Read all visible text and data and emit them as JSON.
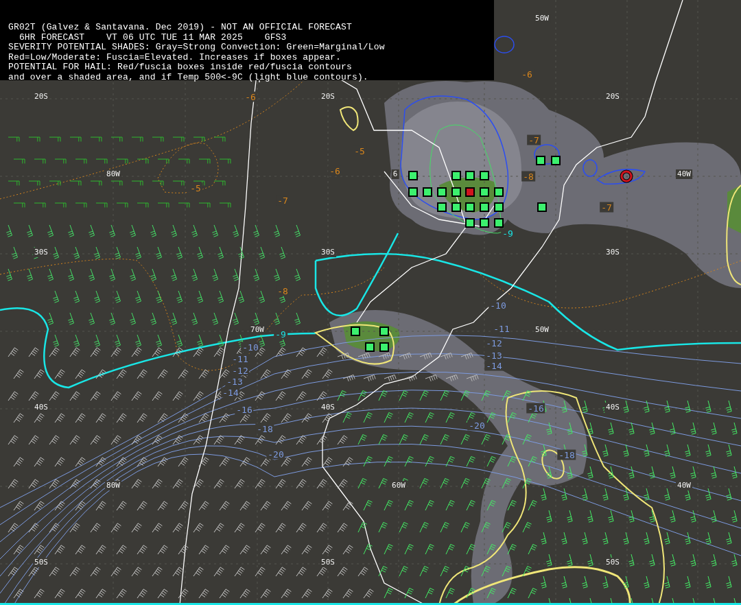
{
  "header": {
    "lines": [
      "GR02T (Galvez & Santavana. Dec 2019) - NOT AN OFFICIAL FORECAST",
      "  6HR FORECAST    VT 06 UTC TUE 11 MAR 2025    GFS3",
      "SEVERITY POTENTIAL SHADES: Gray=Strong Convection: Green=Marginal/Low",
      "Red=Low/Moderate: Fuscia=Elevated. Increases if boxes appear.",
      "POTENTIAL FOR HAIL: Red/fuscia boxes inside red/fuscia contours",
      "and over a shaded area, and if Temp 500<-9C (light blue contours)."
    ]
  },
  "grid_labels": [
    {
      "text": "50W"
    },
    {
      "text": "20S"
    },
    {
      "text": "20S"
    },
    {
      "text": "20S"
    },
    {
      "text": "80W"
    },
    {
      "text": "6"
    },
    {
      "text": "40W"
    },
    {
      "text": "30S"
    },
    {
      "text": "30S"
    },
    {
      "text": "30S"
    },
    {
      "text": "70W"
    },
    {
      "text": "50W"
    },
    {
      "text": "40S"
    },
    {
      "text": "40S"
    },
    {
      "text": "40S"
    },
    {
      "text": "80W"
    },
    {
      "text": "60W"
    },
    {
      "text": "40W"
    },
    {
      "text": "50S"
    },
    {
      "text": "50S"
    },
    {
      "text": "50S"
    }
  ],
  "contour_labels": [
    {
      "text": "-6",
      "kind": "orange"
    },
    {
      "text": "-5",
      "kind": "orange"
    },
    {
      "text": "-6",
      "kind": "orange"
    },
    {
      "text": "-5",
      "kind": "orange"
    },
    {
      "text": "-7",
      "kind": "orange"
    },
    {
      "text": "-8",
      "kind": "orange"
    },
    {
      "text": "-9",
      "kind": "cyan"
    },
    {
      "text": "-6",
      "kind": "orange"
    },
    {
      "text": "-7",
      "kind": "orange"
    },
    {
      "text": "-8",
      "kind": "orange"
    },
    {
      "text": "-7",
      "kind": "orange"
    },
    {
      "text": "-9",
      "kind": "cyan"
    },
    {
      "text": "-10",
      "kind": "blue"
    },
    {
      "text": "-11",
      "kind": "blue"
    },
    {
      "text": "-12",
      "kind": "blue"
    },
    {
      "text": "-13",
      "kind": "blue"
    },
    {
      "text": "-14",
      "kind": "blue"
    },
    {
      "text": "-16",
      "kind": "blue"
    },
    {
      "text": "-18",
      "kind": "blue"
    },
    {
      "text": "-20",
      "kind": "blue"
    },
    {
      "text": "-10",
      "kind": "blue"
    },
    {
      "text": "-11",
      "kind": "blue"
    },
    {
      "text": "-12",
      "kind": "blue"
    },
    {
      "text": "-13",
      "kind": "blue"
    },
    {
      "text": "-14",
      "kind": "blue"
    },
    {
      "text": "-20",
      "kind": "blue"
    },
    {
      "text": "-16",
      "kind": "blue"
    },
    {
      "text": "-18",
      "kind": "blue"
    }
  ],
  "convection_boxes": [
    {
      "kind": "marginal"
    },
    {
      "kind": "marginal"
    },
    {
      "kind": "marginal"
    },
    {
      "kind": "marginal"
    },
    {
      "kind": "marginal"
    },
    {
      "kind": "marginal"
    },
    {
      "kind": "marginal"
    },
    {
      "kind": "marginal"
    },
    {
      "kind": "moderate"
    },
    {
      "kind": "marginal"
    },
    {
      "kind": "marginal"
    },
    {
      "kind": "marginal"
    },
    {
      "kind": "marginal"
    },
    {
      "kind": "marginal"
    },
    {
      "kind": "marginal"
    },
    {
      "kind": "marginal"
    },
    {
      "kind": "marginal"
    },
    {
      "kind": "marginal"
    },
    {
      "kind": "marginal"
    },
    {
      "kind": "marginal"
    },
    {
      "kind": "marginal"
    },
    {
      "kind": "marginal"
    },
    {
      "kind": "marginal"
    },
    {
      "kind": "marginal"
    },
    {
      "kind": "marginal"
    },
    {
      "kind": "marginal"
    }
  ]
}
